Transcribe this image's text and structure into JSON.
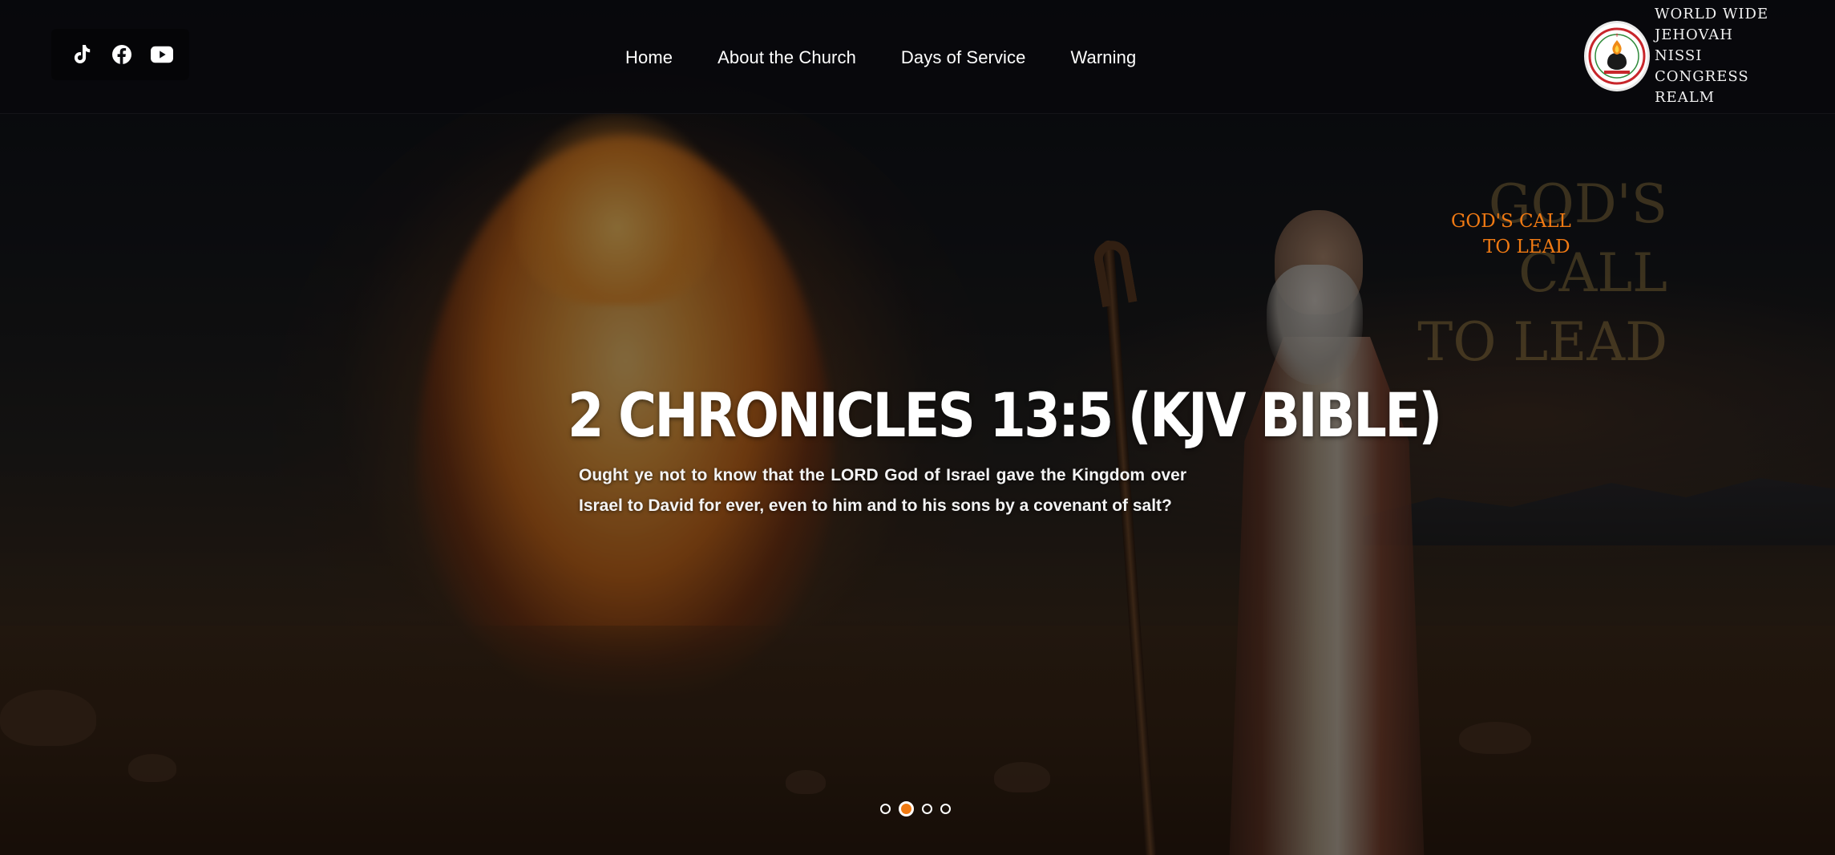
{
  "header": {
    "social": [
      {
        "name": "tiktok-icon"
      },
      {
        "name": "facebook-icon"
      },
      {
        "name": "youtube-icon"
      }
    ],
    "nav": [
      {
        "label": "Home"
      },
      {
        "label": "About the Church"
      },
      {
        "label": "Days of Service"
      },
      {
        "label": "Warning"
      }
    ],
    "logo": {
      "line1": "WORLD WIDE",
      "line2": "JEHOVAH NISSI",
      "line3": "CONGRESS REALM"
    }
  },
  "hero": {
    "image_text": {
      "line1": "GOD'S CALL",
      "line2": "TO LEAD"
    },
    "label": {
      "line1": "GOD'S CALL",
      "line2": "TO LEAD"
    },
    "title": "2 CHRONICLES 13:5 (KJV BIBLE)",
    "verse": "Ought ye not to know that the LORD God of Israel gave the Kingdom over Israel to David for ever, even to him and to his sons by a covenant of salt?"
  },
  "slider": {
    "total": 4,
    "active_index": 1
  },
  "colors": {
    "accent": "#f07a13",
    "header_bg": "#08090c",
    "text": "#ffffff"
  }
}
